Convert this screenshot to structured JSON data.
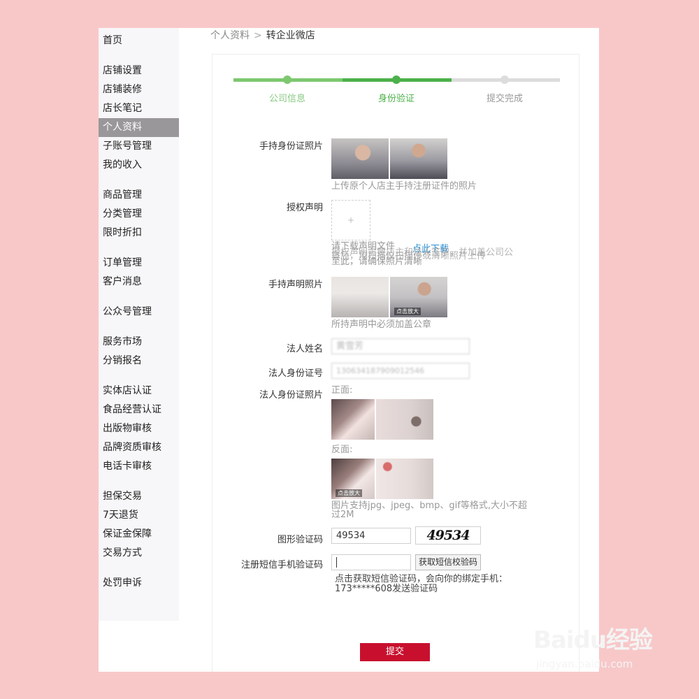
{
  "sidebar": {
    "groups": [
      [
        "首页"
      ],
      [
        "店铺设置",
        "店铺装修",
        "店长笔记",
        "个人资料",
        "子账号管理",
        "我的收入"
      ],
      [
        "商品管理",
        "分类管理",
        "限时折扣"
      ],
      [
        "订单管理",
        "客户消息"
      ],
      [
        "公众号管理"
      ],
      [
        "服务市场",
        "分销报名"
      ],
      [
        "实体店认证",
        "食品经营认证",
        "出版物审核",
        "品牌资质审核",
        "电话卡审核"
      ],
      [
        "担保交易",
        "7天退货",
        "保证金保障",
        "交易方式"
      ],
      [
        "处罚申诉"
      ]
    ],
    "active": "个人资料"
  },
  "breadcrumb": {
    "parent": "个人资料",
    "separator": ">",
    "current": "转企业微店"
  },
  "steps": {
    "items": [
      "公司信息",
      "身份验证",
      "提交完成"
    ],
    "current_index": 1,
    "colors": {
      "done": "#7dc86f",
      "active": "#4cb14a",
      "pending": "#dcdcdc",
      "done_text": "#86c97f",
      "pending_text": "#999999"
    }
  },
  "form": {
    "handheld_id_photo": {
      "label": "手持身份证照片",
      "hint": "上传原个人店主手持注册证件的照片"
    },
    "authorization": {
      "label": "授权声明",
      "upload_placeholder": "+",
      "hint_line1": "请下载声明文件",
      "download_link": "点此下载",
      "hint_overlap1": "授权声明需要店主和法人签字，并加盖公司公",
      "hint_overlap2": "章后，用扫描仪扫描件或清晰照片上传",
      "hint_line3": "至此，请确保照片清晰"
    },
    "handheld_statement_photo": {
      "label": "手持声明照片",
      "hint": "所持声明中必须加盖公章"
    },
    "legal_name": {
      "label": "法人姓名",
      "value": "黄雪芳"
    },
    "legal_id_number": {
      "label": "法人身份证号",
      "value": "130634187909012546"
    },
    "legal_id_photo": {
      "label": "法人身份证照片",
      "front_label": "正面:",
      "back_label": "反面:",
      "hint": "图片支持jpg、jpeg、bmp、gif等格式,大小不超 过2M"
    },
    "captcha": {
      "label": "图形验证码",
      "value": "49534",
      "image_text": "49534"
    },
    "sms": {
      "label": "注册短信手机验证码",
      "value": "",
      "button": "获取短信校验码",
      "hint": "点击获取短信验证码，会向你的绑定手机：173*****608发送验证码"
    },
    "photo_tags": {
      "zoom": "点击放大"
    },
    "submit": "提交"
  },
  "watermark": {
    "brand": "Baidu经验",
    "url": "jingyan.baidu.com"
  }
}
